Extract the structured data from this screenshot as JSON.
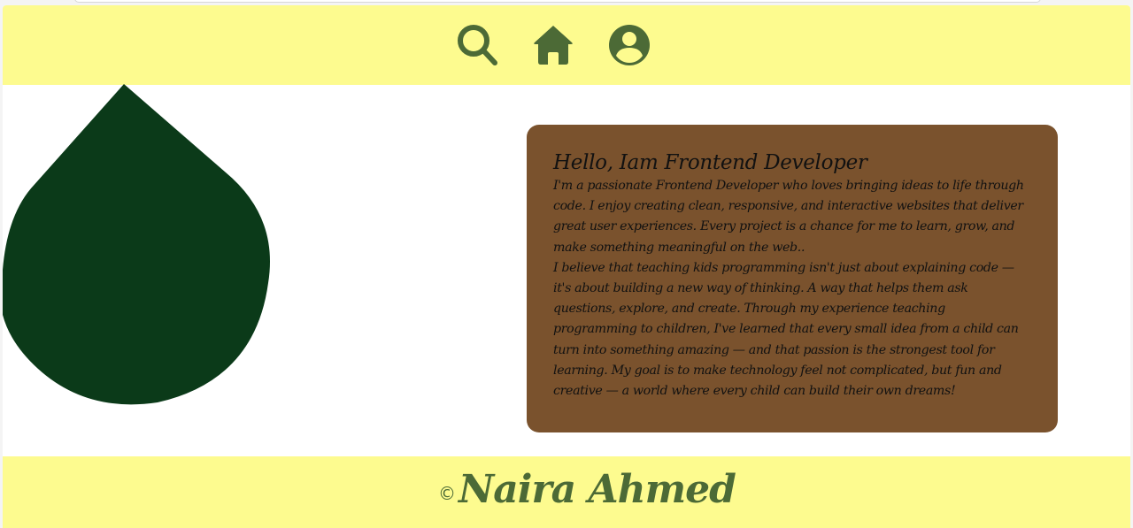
{
  "header": {
    "icons": [
      {
        "name": "search-icon"
      },
      {
        "name": "home-icon"
      },
      {
        "name": "user-account-icon"
      }
    ]
  },
  "hero": {
    "shape": "leaf-drop",
    "color": "#0b3a19"
  },
  "about": {
    "title": "Hello, Iam Frontend Developer",
    "paragraph1": "I'm a passionate Frontend Developer who loves bringing ideas to life through code. I enjoy creating clean, responsive, and interactive websites that deliver great user experiences. Every project is a chance for me to learn, grow, and make something meaningful on the web..",
    "paragraph2": "I believe that teaching kids programming isn't just about explaining code — it's about building a new way of thinking. A way that helps them ask questions, explore, and create. Through my experience teaching programming to children, I've learned that every small idea from a child can turn into something amazing — and that passion is the strongest tool for learning. My goal is to make technology feel not complicated, but fun and creative — a world where every child can build their own dreams!"
  },
  "footer": {
    "copyright_symbol": "©",
    "name": "Naira Ahmed"
  },
  "colors": {
    "header_bg": "#fdfb8f",
    "icon_color": "#4c6a36",
    "card_bg": "#7a522d",
    "leaf": "#0b3a19"
  }
}
